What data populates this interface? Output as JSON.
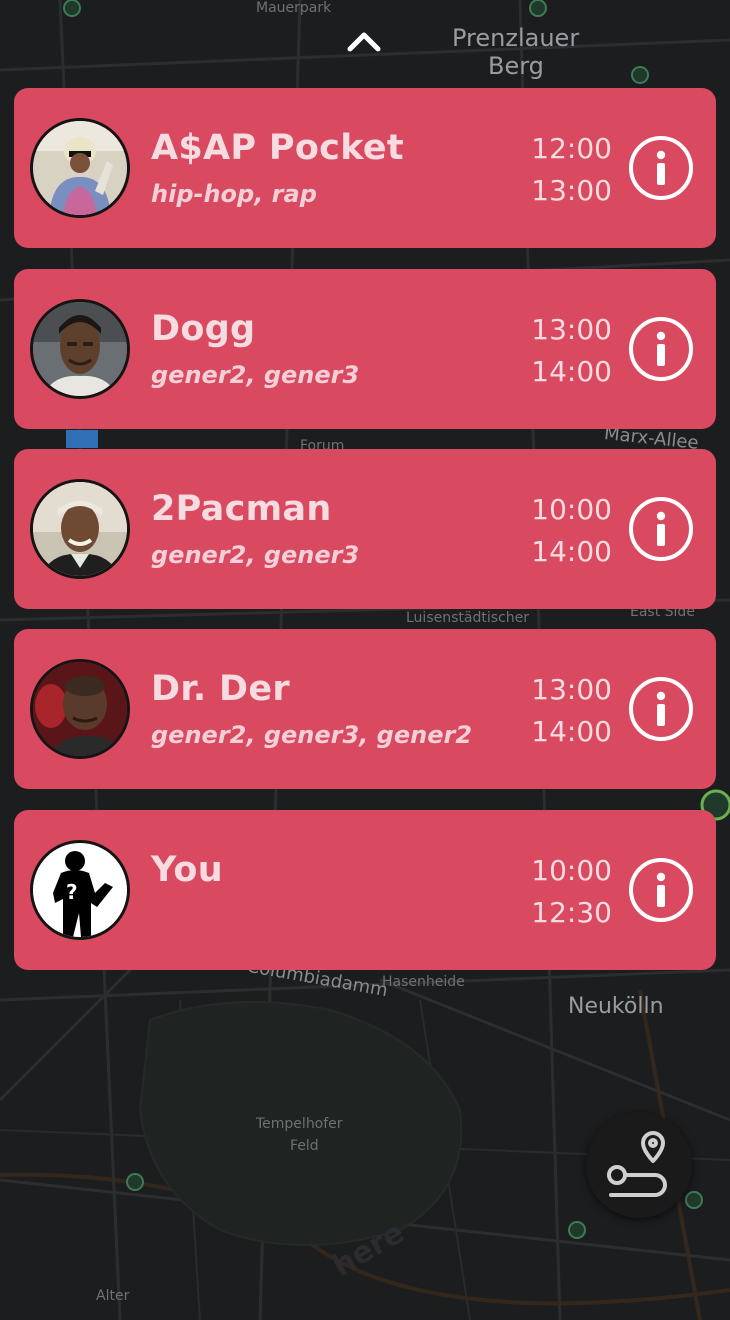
{
  "map": {
    "labels": {
      "mauerpark": "Mauerpark",
      "prenzlauer": "Prenzlauer",
      "berg": "Berg",
      "forum": "Forum",
      "karl_marx_allee": "Marx-Allee",
      "luisenstadtischer": "Luisenstädtischer",
      "east_side": "East Side",
      "columbiadamm": "Columbiadamm",
      "hasenheide": "Hasenheide",
      "neukolln": "Neukölln",
      "tempelhofer": "Tempelhofer",
      "feld": "Feld",
      "alter": "Alter",
      "here": "here"
    }
  },
  "colors": {
    "card": "#d9495f",
    "text": "#f6dbe0",
    "map_bg": "#1b1c1e"
  },
  "artists": [
    {
      "name": "A$AP Pocket",
      "genres": "hip-hop, rap",
      "start": "12:00",
      "end": "13:00",
      "avatar": "asap-avatar"
    },
    {
      "name": "Dogg",
      "genres": "gener2, gener3",
      "start": "13:00",
      "end": "14:00",
      "avatar": "dogg-avatar"
    },
    {
      "name": "2Pacman",
      "genres": "gener2, gener3",
      "start": "10:00",
      "end": "14:00",
      "avatar": "pacman-avatar"
    },
    {
      "name": "Dr. Der",
      "genres": "gener2, gener3, gener2",
      "start": "13:00",
      "end": "14:00",
      "avatar": "drder-avatar"
    },
    {
      "name": "You",
      "genres": "",
      "start": "10:00",
      "end": "12:30",
      "avatar": "unknown-silhouette-avatar"
    }
  ],
  "icons": {
    "collapse": "chevron-up-icon",
    "info": "info-icon",
    "route": "route-icon"
  }
}
